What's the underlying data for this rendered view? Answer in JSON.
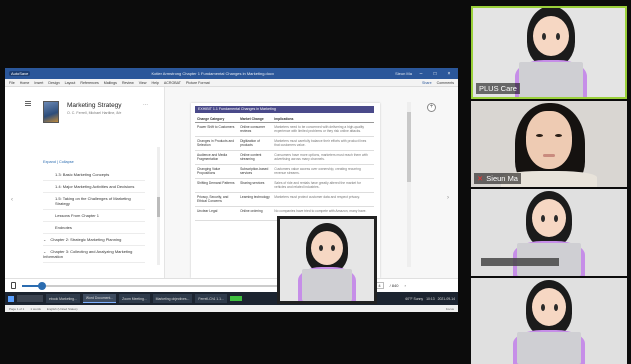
{
  "window": {
    "autosave": "AutoSave",
    "title": "Kotler Armstrong Chapter 1 Fundamental Changes in Marketing.docx",
    "user": "Sieun Ma",
    "controls": [
      "–",
      "□",
      "×"
    ]
  },
  "ribbon": {
    "tabs": [
      "File",
      "Home",
      "Insert",
      "Design",
      "Layout",
      "References",
      "Mailings",
      "Review",
      "View",
      "Help",
      "ACROBAT",
      "Picture Format"
    ],
    "share": "Share",
    "comments": "Comments"
  },
  "book": {
    "title": "Marketing Strategy",
    "author": "O. C. Ferrell, Michael Hartline, 8/e",
    "expand_collapse": "Expand | Collapse"
  },
  "toc": [
    {
      "label": "1.3: Basic Marketing Concepts",
      "type": "section"
    },
    {
      "label": "1.4: Major Marketing Activities and Decisions",
      "type": "section"
    },
    {
      "label": "1.5: Taking on the Challenges of Marketing Strategy",
      "type": "section"
    },
    {
      "label": "Lessons From Chapter 1",
      "type": "section"
    },
    {
      "label": "Endnotes",
      "type": "section"
    },
    {
      "label": "Chapter 2: Strategic Marketing Planning",
      "type": "chapter"
    },
    {
      "label": "Chapter 3: Collecting and Analyzing Marketing Information",
      "type": "chapter"
    }
  ],
  "exhibit": {
    "title": "EXHIBIT 1.1 Fundamental Changes in Marketing",
    "headers": [
      "Change Category",
      "Market Change",
      "Implications"
    ],
    "rows": [
      {
        "category": "Power Shift to Customers",
        "change": "Online consumer reviews",
        "implication": "Marketers need to be concerned with delivering a high-quality experience with limited problems or they risk online attacks."
      },
      {
        "category": "Changes in Products and Selection",
        "change": "Digitization of products",
        "implication": "Marketers must carefully balance their efforts with product lines that customers value."
      },
      {
        "category": "Audience and Media Fragmentation",
        "change": "Online content streaming",
        "implication": "Consumers have more options, marketers must reach them with advertising across many channels."
      },
      {
        "category": "Changing Value Propositions",
        "change": "Subscription-based services",
        "implication": "Customers value access over ownership, creating recurring revenue streams."
      },
      {
        "category": "Shifting Demand Patterns",
        "change": "Sharing services",
        "implication": "Sales of ride and rentals have greatly altered the market for vehicles and related industries."
      },
      {
        "category": "Privacy, Security, and Ethical Concerns",
        "change": "Learning technology",
        "implication": "Marketers must protect customer data and respect privacy."
      },
      {
        "category": "Unclear Legal",
        "change": "Online ordering",
        "implication": "No companies have tried to compete with Amazon, many have."
      }
    ]
  },
  "bottom": {
    "page_current": "4",
    "page_total": "/ 840",
    "slider_fraction": 0.06
  },
  "taskbar": {
    "apps": [
      "ebook Marketing...",
      "Word Document...",
      "Zoom Meeting...",
      "Marketing objectives...",
      "Ferrell-Ch1 1.1..."
    ],
    "weather": "60°F Sunny",
    "time": "10:13",
    "date": "2021-09-14"
  },
  "statusbar": {
    "page": "Page 1 of 1",
    "words": "1 words",
    "lang": "English (United States)",
    "focus": "Focus"
  },
  "participants": [
    {
      "name": "PLUS Care",
      "muted": false,
      "active": true
    },
    {
      "name": "Sieun Ma",
      "muted": true,
      "active": false
    },
    {
      "name": "",
      "muted": false,
      "active": false
    },
    {
      "name": "",
      "muted": false,
      "active": false
    }
  ]
}
